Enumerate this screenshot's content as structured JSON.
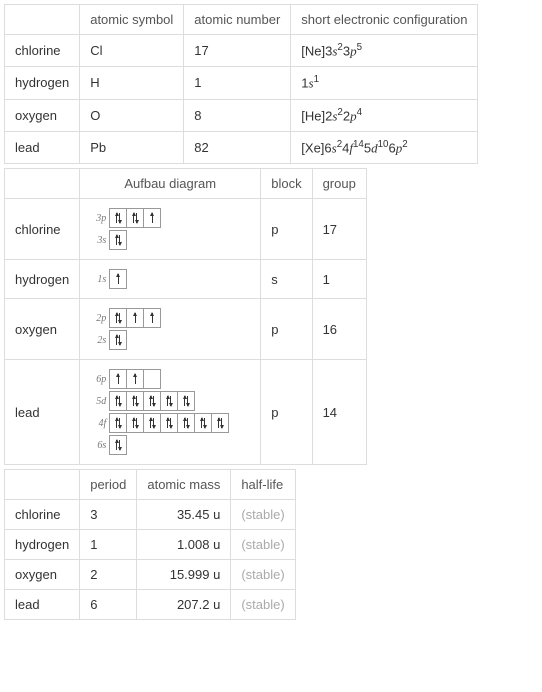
{
  "table1": {
    "headers": [
      "",
      "atomic symbol",
      "atomic number",
      "short electronic configuration"
    ],
    "rows": [
      {
        "name": "chlorine",
        "symbol": "Cl",
        "number": "17",
        "config_prefix": "[Ne]",
        "config": [
          [
            "3",
            "s",
            "2"
          ],
          [
            "3",
            "p",
            "5"
          ]
        ]
      },
      {
        "name": "hydrogen",
        "symbol": "H",
        "number": "1",
        "config_prefix": "",
        "config": [
          [
            "1",
            "s",
            "1"
          ]
        ]
      },
      {
        "name": "oxygen",
        "symbol": "O",
        "number": "8",
        "config_prefix": "[He]",
        "config": [
          [
            "2",
            "s",
            "2"
          ],
          [
            "2",
            "p",
            "4"
          ]
        ]
      },
      {
        "name": "lead",
        "symbol": "Pb",
        "number": "82",
        "config_prefix": "[Xe]",
        "config": [
          [
            "6",
            "s",
            "2"
          ],
          [
            "4",
            "f",
            "14"
          ],
          [
            "5",
            "d",
            "10"
          ],
          [
            "6",
            "p",
            "2"
          ]
        ]
      }
    ]
  },
  "table2": {
    "headers": [
      "",
      "Aufbau diagram",
      "block",
      "group"
    ],
    "rows": [
      {
        "name": "chlorine",
        "block": "p",
        "group": "17",
        "orbitals": [
          {
            "label": "3p",
            "boxes": [
              2,
              2,
              1
            ]
          },
          {
            "label": "3s",
            "boxes": [
              2
            ]
          }
        ]
      },
      {
        "name": "hydrogen",
        "block": "s",
        "group": "1",
        "orbitals": [
          {
            "label": "1s",
            "boxes": [
              1
            ]
          }
        ]
      },
      {
        "name": "oxygen",
        "block": "p",
        "group": "16",
        "orbitals": [
          {
            "label": "2p",
            "boxes": [
              2,
              1,
              1
            ]
          },
          {
            "label": "2s",
            "boxes": [
              2
            ]
          }
        ]
      },
      {
        "name": "lead",
        "block": "p",
        "group": "14",
        "orbitals": [
          {
            "label": "6p",
            "boxes": [
              1,
              1,
              0
            ]
          },
          {
            "label": "5d",
            "boxes": [
              2,
              2,
              2,
              2,
              2
            ]
          },
          {
            "label": "4f",
            "boxes": [
              2,
              2,
              2,
              2,
              2,
              2,
              2
            ]
          },
          {
            "label": "6s",
            "boxes": [
              2
            ]
          }
        ]
      }
    ]
  },
  "table3": {
    "headers": [
      "",
      "period",
      "atomic mass",
      "half-life"
    ],
    "rows": [
      {
        "name": "chlorine",
        "period": "3",
        "mass": "35.45 u",
        "half": "(stable)"
      },
      {
        "name": "hydrogen",
        "period": "1",
        "mass": "1.008 u",
        "half": "(stable)"
      },
      {
        "name": "oxygen",
        "period": "2",
        "mass": "15.999 u",
        "half": "(stable)"
      },
      {
        "name": "lead",
        "period": "6",
        "mass": "207.2 u",
        "half": "(stable)"
      }
    ]
  }
}
